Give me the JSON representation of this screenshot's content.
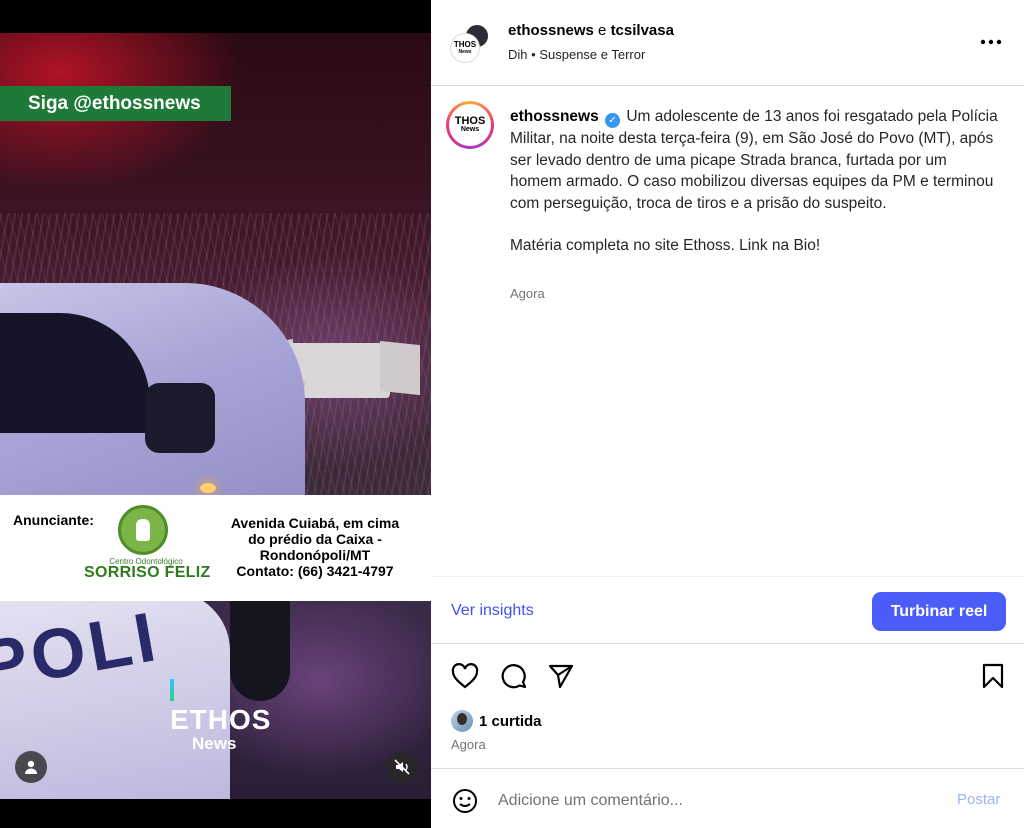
{
  "media": {
    "follow_tag": "Siga @ethossnews",
    "ad": {
      "label": "Anunciante:",
      "logo_small_text": "Centro Odontológico",
      "logo_brand": "SORRISO FELIZ",
      "address_lines": [
        "Avenida Cuiabá, em cima",
        "do prédio da Caixa -",
        "Rondonópoli/MT",
        "Contato: (66) 3421-4797"
      ]
    },
    "watermark_top": "ETHOS",
    "watermark_bottom": "News",
    "vehicle_text": "POLI",
    "icons": {
      "user_tag": "user-icon",
      "audio": "muted-speaker-icon"
    }
  },
  "header": {
    "user1": "ethossnews",
    "conjunction": "e",
    "user2": "tcsilvasa",
    "audio_artist": "Dih",
    "separator": "•",
    "audio_title": "Suspense e Terror",
    "avatar_text_top": "THOS",
    "avatar_text_bottom": "News",
    "more_icon": "more-horizontal-icon"
  },
  "caption": {
    "username": "ethossnews",
    "verified_mark": "✓",
    "text": "Um adolescente de 13 anos foi resgatado pela Polícia Militar, na noite desta terça-feira (9), em São José do Povo (MT), após ser levado dentro de uma picape Strada branca, furtada por um homem armado. O caso mobilizou diversas equipes da PM e terminou com perseguição, troca de tiros e a prisão do suspeito.",
    "text2": "Matéria completa no site Ethoss. Link na Bio!",
    "time": "Agora"
  },
  "insights": {
    "link": "Ver insights",
    "boost_button": "Turbinar reel"
  },
  "actions": {
    "like_icon": "heart-icon",
    "comment_icon": "comment-icon",
    "share_icon": "send-icon",
    "save_icon": "bookmark-icon",
    "likes_count": "1 curtida",
    "time": "Agora"
  },
  "comment": {
    "placeholder": "Adicione um comentário...",
    "post_button": "Postar",
    "emoji_icon": "emoji-icon"
  },
  "colors": {
    "accent": "#4a5df9",
    "link": "#4150f7",
    "follow_tag_bg": "#1f7a3a",
    "verified": "#3797f0"
  }
}
